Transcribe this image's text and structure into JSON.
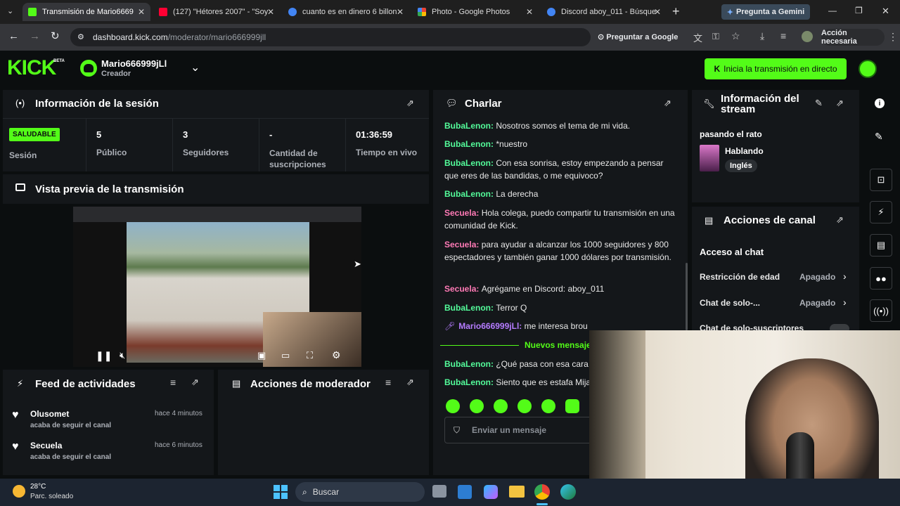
{
  "browser": {
    "tabs": [
      {
        "title": "Transmisión de Mario6669",
        "color": "#53fc18"
      },
      {
        "title": "(127) \"Hétores 2007\" - \"Soy",
        "color": "#ff0033"
      },
      {
        "title": "cuanto es en dinero 6 billon",
        "color": "#4285f4"
      },
      {
        "title": "Photo - Google Photos",
        "color": "#fbbc04"
      },
      {
        "title": "Discord aboy_011 - Búsque",
        "color": "#4285f4"
      }
    ],
    "gemini_button": "Pregunta a Gemini",
    "url_host": "dashboard.kick.com",
    "url_path": "/moderator/mario666999jll",
    "ask_google": "Preguntar a Google",
    "action_needed": "Acción necesaria"
  },
  "header": {
    "logo": "KICK",
    "beta": "BETA",
    "username": "Mario666999jLl",
    "role": "Creador",
    "go_live": "Inicia la transmisión en directo"
  },
  "session": {
    "title": "Información de la sesión",
    "status_badge": "SALUDABLE",
    "status_label": "Sesión",
    "stats": [
      {
        "value": "5",
        "label": "Público"
      },
      {
        "value": "3",
        "label": "Seguidores"
      },
      {
        "value": "-",
        "label": "Cantidad de suscripciones"
      },
      {
        "value": "01:36:59",
        "label": "Tiempo en vivo"
      }
    ]
  },
  "preview": {
    "title": "Vista previa de la transmisión"
  },
  "feed": {
    "title": "Feed de actividades",
    "items": [
      {
        "name": "Olusomet",
        "time": "hace 4 minutos",
        "action": "acaba de seguir el canal"
      },
      {
        "name": "Secuela",
        "time": "hace 6 minutos",
        "action": "acaba de seguir el canal"
      }
    ]
  },
  "modactions": {
    "title": "Acciones de moderador"
  },
  "chat": {
    "title": "Charlar",
    "messages": [
      {
        "user": "BubaLenon",
        "color": "#53fc9a",
        "text": "Nosotros somos el tema de mi vida."
      },
      {
        "user": "BubaLenon",
        "color": "#53fc9a",
        "text": "*nuestro"
      },
      {
        "user": "BubaLenon",
        "color": "#53fc9a",
        "text": "Con esa sonrisa, estoy empezando a pensar que eres de las bandidas, o me equivoco?"
      },
      {
        "user": "BubaLenon",
        "color": "#53fc9a",
        "text": "La derecha"
      },
      {
        "user": "Secuela",
        "color": "#ff7ab6",
        "text": "Hola colega, puedo compartir tu transmisión en una comunidad de Kick."
      },
      {
        "user": "Secuela",
        "color": "#ff7ab6",
        "text": "para ayudar a alcanzar los 1000 seguidores y 800 espectadores y también ganar 1000 dólares por transmisión."
      },
      {
        "user": "Secuela",
        "color": "#ff7ab6",
        "text": "Agrégame en Discord: aboy_011"
      },
      {
        "user": "BubaLenon",
        "color": "#53fc9a",
        "text": "Terror Q"
      },
      {
        "user": "Mario666999jLl",
        "color": "#b57cff",
        "text": "me interesa brou"
      }
    ],
    "new_messages": "Nuevos mensaje",
    "new": [
      {
        "user": "BubaLenon",
        "color": "#53fc9a",
        "text": "¿Qué pasa con esa cara"
      },
      {
        "user": "BubaLenon",
        "color": "#53fc9a",
        "text": "Siento que es estafa Mija"
      }
    ],
    "placeholder": "Enviar un mensaje"
  },
  "stream_info": {
    "title": "Información del stream",
    "stream_title": "pasando el rato",
    "category": "Hablando",
    "language": "Inglés"
  },
  "channel_actions": {
    "title": "Acciones de canal",
    "section": "Acceso al chat",
    "rows": [
      {
        "label": "Restricción de edad",
        "value": "Apagado"
      },
      {
        "label": "Chat de solo-...",
        "value": "Apagado"
      },
      {
        "label": "Chat de solo-suscriptores",
        "value": ""
      }
    ]
  },
  "taskbar": {
    "temp": "28°C",
    "weather": "Parc. soleado",
    "search": "Buscar"
  }
}
